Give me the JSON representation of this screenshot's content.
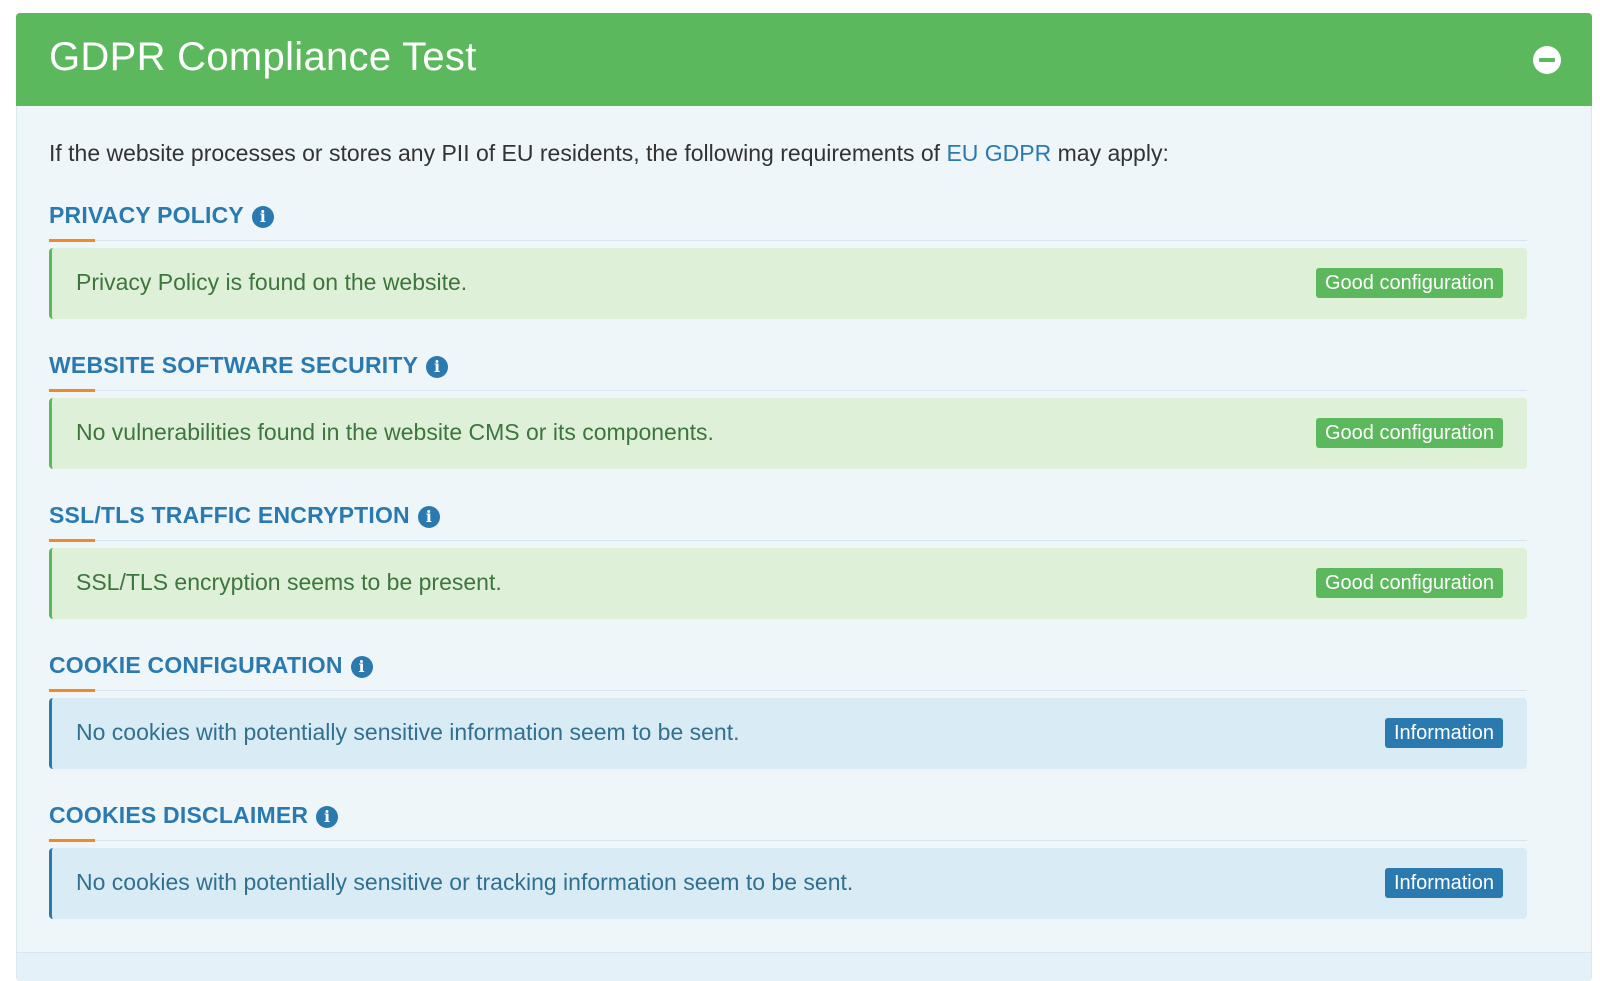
{
  "panel": {
    "title": "GDPR Compliance Test",
    "collapse_icon": "minus-circle-icon"
  },
  "intro": {
    "text_before": "If the website processes or stores any PII of EU residents, the following requirements of ",
    "link": "EU GDPR",
    "text_after": " may apply:"
  },
  "colors": {
    "header_green": "#5cb85c",
    "heading_blue": "#2a7ab0",
    "underline_orange": "#f08a24",
    "good_bg": "#dff0d8",
    "info_bg": "#d9ecf6"
  },
  "sections": [
    {
      "title": "PRIVACY POLICY",
      "info_icon": "info-circle-icon",
      "result_text": "Privacy Policy is found on the website.",
      "status": "good",
      "badge": "Good configuration"
    },
    {
      "title": "WEBSITE SOFTWARE SECURITY",
      "info_icon": "info-circle-icon",
      "result_text": "No vulnerabilities found in the website CMS or its components.",
      "status": "good",
      "badge": "Good configuration"
    },
    {
      "title": "SSL/TLS TRAFFIC ENCRYPTION",
      "info_icon": "info-circle-icon",
      "result_text": "SSL/TLS encryption seems to be present.",
      "status": "good",
      "badge": "Good configuration"
    },
    {
      "title": "COOKIE CONFIGURATION",
      "info_icon": "info-circle-icon",
      "result_text": "No cookies with potentially sensitive information seem to be sent.",
      "status": "info",
      "badge": "Information"
    },
    {
      "title": "COOKIES DISCLAIMER",
      "info_icon": "info-circle-icon",
      "result_text": "No cookies with potentially sensitive or tracking information seem to be sent.",
      "status": "info",
      "badge": "Information"
    }
  ]
}
